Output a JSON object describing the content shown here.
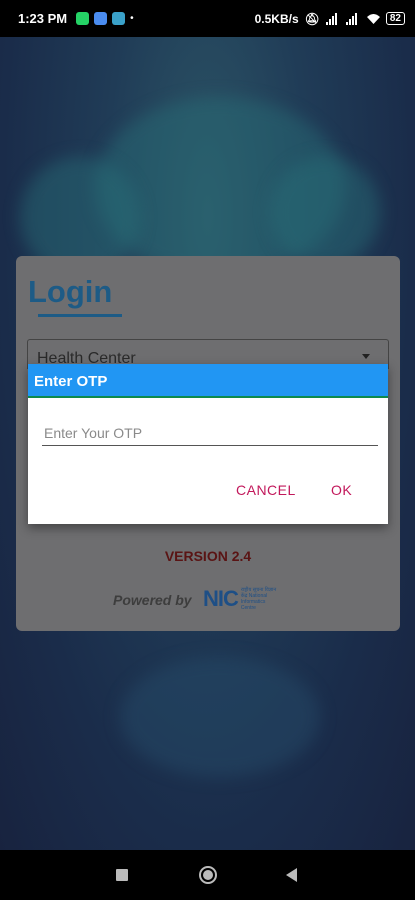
{
  "status_bar": {
    "time": "1:23 PM",
    "net_speed": "0.5KB/s",
    "battery": "82",
    "app_icons": [
      "whatsapp-icon",
      "phone-icon",
      "app-icon"
    ],
    "indicator_icons": [
      "alarm-mute-icon",
      "signal-icon",
      "signal-icon",
      "wifi-icon"
    ]
  },
  "login": {
    "title": "Login",
    "selected_option": "Health Center",
    "version": "VERSION 2.4",
    "powered_by": "Powered by",
    "logo_text": "NIC",
    "logo_subtext": "राष्ट्रीय सूचना विज्ञान केंद्र National Informatics Centre"
  },
  "dialog": {
    "title": "Enter OTP",
    "input_placeholder": "Enter Your OTP",
    "input_value": "",
    "cancel_label": "CANCEL",
    "ok_label": "OK"
  },
  "colors": {
    "header": "#2196f3",
    "accent": "#c2185b",
    "title": "#1d5b86"
  }
}
